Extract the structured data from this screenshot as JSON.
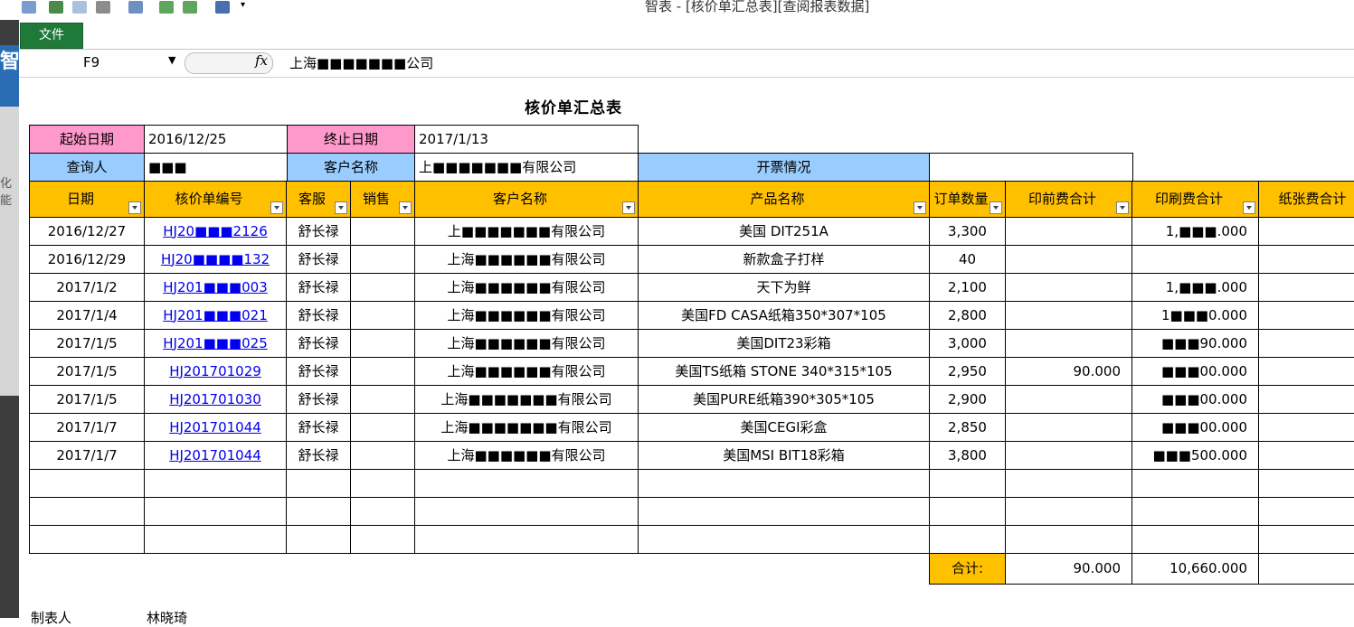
{
  "window": {
    "title": "智表 - [核价单汇总表][查阅报表数据]",
    "file_tab": "文件"
  },
  "formula_bar": {
    "cell_ref": "F9",
    "fx_label": "fx",
    "content": "上海■■■■■■■公司"
  },
  "report": {
    "title": "核价单汇总表",
    "filters": {
      "start_label": "起始日期",
      "start_value": "2016/12/25",
      "end_label": "终止日期",
      "end_value": "2017/1/13",
      "query_label": "查询人",
      "query_value": "■■■",
      "customer_label": "客户名称",
      "customer_value": "上■■■■■■■有限公司",
      "invoice_label": "开票情况",
      "invoice_value": ""
    },
    "columns": [
      "日期",
      "核价单编号",
      "客服",
      "销售",
      "客户名称",
      "产品名称",
      "订单数量",
      "印前费合计",
      "印刷费合计",
      "纸张费合计"
    ],
    "rows": [
      {
        "date": "2016/12/27",
        "id": "HJ20■■■2126",
        "cs": "舒长禄",
        "sales": "",
        "customer": "上■■■■■■■有限公司",
        "product": "美国 DIT251A",
        "qty": "3,300",
        "prepress": "",
        "printing": "1,■■■.000"
      },
      {
        "date": "2016/12/29",
        "id": "HJ20■■■■132",
        "cs": "舒长禄",
        "sales": "",
        "customer": "上海■■■■■■有限公司",
        "product": "新款盒子打样",
        "qty": "40",
        "prepress": "",
        "printing": ""
      },
      {
        "date": "2017/1/2",
        "id": "HJ201■■■003",
        "cs": "舒长禄",
        "sales": "",
        "customer": "上海■■■■■■有限公司",
        "product": "天下为鲜",
        "qty": "2,100",
        "prepress": "",
        "printing": "1,■■■.000"
      },
      {
        "date": "2017/1/4",
        "id": "HJ201■■■021",
        "cs": "舒长禄",
        "sales": "",
        "customer": "上海■■■■■■有限公司",
        "product": "美国FD CASA纸箱350*307*105",
        "qty": "2,800",
        "prepress": "",
        "printing": "1■■■0.000"
      },
      {
        "date": "2017/1/5",
        "id": "HJ201■■■025",
        "cs": "舒长禄",
        "sales": "",
        "customer": "上海■■■■■■有限公司",
        "product": "美国DIT23彩箱",
        "qty": "3,000",
        "prepress": "",
        "printing": "■■■90.000"
      },
      {
        "date": "2017/1/5",
        "id": "HJ201701029",
        "cs": "舒长禄",
        "sales": "",
        "customer": "上海■■■■■■有限公司",
        "product": "美国TS纸箱 STONE 340*315*105",
        "qty": "2,950",
        "prepress": "90.000",
        "printing": "■■■00.000"
      },
      {
        "date": "2017/1/5",
        "id": "HJ201701030",
        "cs": "舒长禄",
        "sales": "",
        "customer": "上海■■■■■■■有限公司",
        "product": "美国PURE纸箱390*305*105",
        "qty": "2,900",
        "prepress": "",
        "printing": "■■■00.000"
      },
      {
        "date": "2017/1/7",
        "id": "HJ201701044",
        "cs": "舒长禄",
        "sales": "",
        "customer": "上海■■■■■■■有限公司",
        "product": "美国CEGI彩盒",
        "qty": "2,850",
        "prepress": "",
        "printing": "■■■00.000"
      },
      {
        "date": "2017/1/7",
        "id": "HJ201701044",
        "cs": "舒长禄",
        "sales": "",
        "customer": "上海■■■■■■有限公司",
        "product": "美国MSI BIT18彩箱",
        "qty": "3,800",
        "prepress": "",
        "printing": "■■■500.000"
      }
    ],
    "total_label": "合计:",
    "total_prepress": "90.000",
    "total_printing": "10,660.000"
  },
  "footer": {
    "maker_label": "制表人",
    "maker_value": "林晓琦"
  },
  "sidebar": {
    "label": "化能"
  },
  "colors": {
    "pink": "#ff99cc",
    "light_blue": "#99ccff",
    "gold": "#ffc000",
    "file_tab": "#1f7a3a",
    "link": "#0000ee"
  },
  "icons": [
    "undo-icon",
    "redo-icon",
    "preview-icon",
    "print-icon",
    "copy-icon",
    "add-row-icon",
    "delete-row-icon",
    "exit-icon",
    "customize-arrow-icon",
    "fx-icon",
    "dropdown-arrow-icon",
    "filter-arrow-icon"
  ]
}
